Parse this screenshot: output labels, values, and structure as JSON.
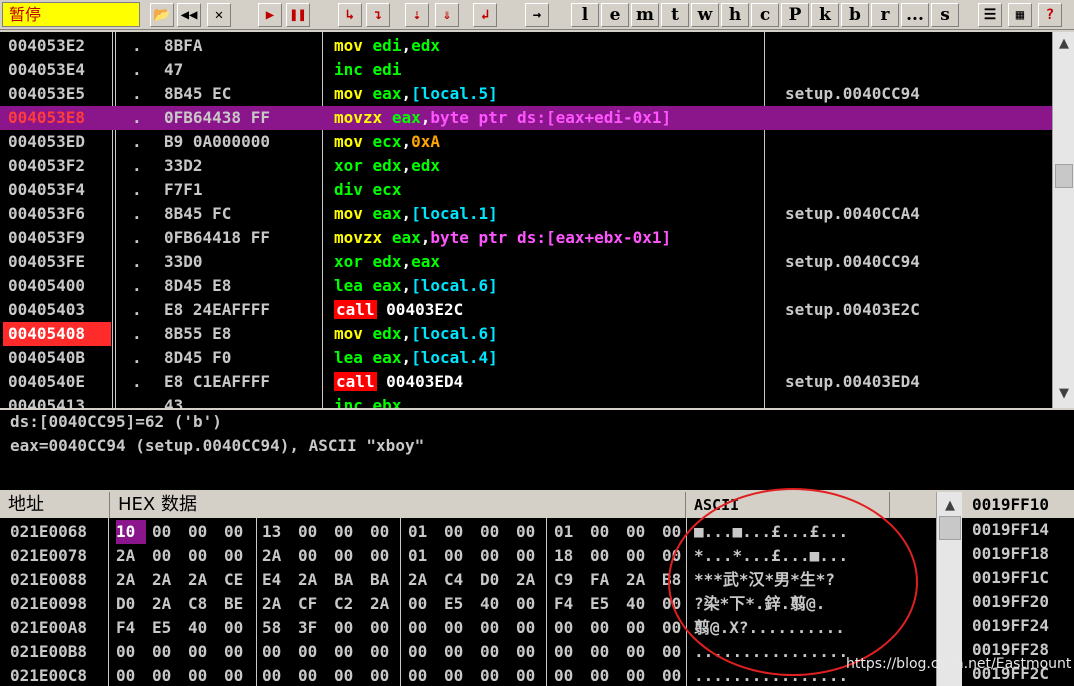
{
  "toolbar": {
    "status": "暂停",
    "buttons": [
      {
        "name": "open-icon",
        "glyph": "📂"
      },
      {
        "name": "rewind-icon",
        "glyph": "◀◀"
      },
      {
        "name": "close-icon",
        "glyph": "✕"
      },
      {
        "name": "run-icon",
        "glyph": "▶"
      },
      {
        "name": "pause-icon",
        "glyph": "❚❚"
      },
      {
        "name": "step-into-icon",
        "glyph": "↳"
      },
      {
        "name": "step-over-icon",
        "glyph": "↴"
      },
      {
        "name": "trace-into-icon",
        "glyph": "⇣"
      },
      {
        "name": "trace-over-icon",
        "glyph": "⇓"
      },
      {
        "name": "execute-till-return-icon",
        "glyph": "↲"
      },
      {
        "name": "goto-icon",
        "glyph": "→"
      }
    ],
    "letters": [
      "l",
      "e",
      "m",
      "t",
      "w",
      "h",
      "c",
      "P",
      "k",
      "b",
      "r",
      "...",
      "s"
    ],
    "right_buttons": [
      {
        "name": "list-icon",
        "glyph": "☰"
      },
      {
        "name": "grid-icon",
        "glyph": "▦"
      },
      {
        "name": "help-icon",
        "glyph": "?"
      }
    ]
  },
  "disasm": [
    {
      "addr": "004053E2",
      "bytes": "8BFA",
      "mn": "mov",
      "ops": [
        [
          "op-reg",
          "edi"
        ],
        [
          "op-plain",
          ","
        ],
        [
          "op-reg",
          "edx"
        ]
      ],
      "cmt": ""
    },
    {
      "addr": "004053E4",
      "bytes": "47",
      "mn": "inc",
      "ops": [
        [
          "op-reg",
          "edi"
        ]
      ],
      "cmt": ""
    },
    {
      "addr": "004053E5",
      "bytes": "8B45 EC",
      "mn": "mov",
      "ops": [
        [
          "op-reg",
          "eax"
        ],
        [
          "op-plain",
          ","
        ],
        [
          "op-mem",
          "[local.5]"
        ]
      ],
      "cmt": "setup.0040CC94"
    },
    {
      "addr": "004053E8",
      "bytes": "0FB64438 FF",
      "mn": "movzx",
      "ops": [
        [
          "op-reg",
          "eax"
        ],
        [
          "op-plain",
          ","
        ],
        [
          "op-bp",
          "byte ptr ds:[eax+edi-0x1]"
        ]
      ],
      "cmt": "",
      "hl": true
    },
    {
      "addr": "004053ED",
      "bytes": "B9 0A000000",
      "mn": "mov",
      "ops": [
        [
          "op-reg",
          "ecx"
        ],
        [
          "op-plain",
          ","
        ],
        [
          "op-imm",
          "0xA"
        ]
      ],
      "cmt": ""
    },
    {
      "addr": "004053F2",
      "bytes": "33D2",
      "mn": "xor",
      "ops": [
        [
          "op-reg",
          "edx"
        ],
        [
          "op-plain",
          ","
        ],
        [
          "op-reg",
          "edx"
        ]
      ],
      "cmt": ""
    },
    {
      "addr": "004053F4",
      "bytes": "F7F1",
      "mn": "div",
      "ops": [
        [
          "op-reg",
          "ecx"
        ]
      ],
      "cmt": ""
    },
    {
      "addr": "004053F6",
      "bytes": "8B45 FC",
      "mn": "mov",
      "ops": [
        [
          "op-reg",
          "eax"
        ],
        [
          "op-plain",
          ","
        ],
        [
          "op-mem",
          "[local.1]"
        ]
      ],
      "cmt": "setup.0040CCA4"
    },
    {
      "addr": "004053F9",
      "bytes": "0FB64418 FF",
      "mn": "movzx",
      "ops": [
        [
          "op-reg",
          "eax"
        ],
        [
          "op-plain",
          ","
        ],
        [
          "op-bp",
          "byte ptr ds:[eax+ebx-0x1]"
        ]
      ],
      "cmt": ""
    },
    {
      "addr": "004053FE",
      "bytes": "33D0",
      "mn": "xor",
      "ops": [
        [
          "op-reg",
          "edx"
        ],
        [
          "op-plain",
          ","
        ],
        [
          "op-reg",
          "eax"
        ]
      ],
      "cmt": "setup.0040CC94"
    },
    {
      "addr": "00405400",
      "bytes": "8D45 E8",
      "mn": "lea",
      "ops": [
        [
          "op-reg",
          "eax"
        ],
        [
          "op-plain",
          ","
        ],
        [
          "op-mem",
          "[local.6]"
        ]
      ],
      "cmt": ""
    },
    {
      "addr": "00405403",
      "bytes": "E8 24EAFFFF",
      "mn": "call",
      "ops": [
        [
          "op-plain",
          "00403E2C"
        ]
      ],
      "cmt": "setup.00403E2C"
    },
    {
      "addr": "00405408",
      "bytes": "8B55 E8",
      "mn": "mov",
      "ops": [
        [
          "op-reg",
          "edx"
        ],
        [
          "op-plain",
          ","
        ],
        [
          "op-mem",
          "[local.6]"
        ]
      ],
      "cmt": "",
      "bp": true
    },
    {
      "addr": "0040540B",
      "bytes": "8D45 F0",
      "mn": "lea",
      "ops": [
        [
          "op-reg",
          "eax"
        ],
        [
          "op-plain",
          ","
        ],
        [
          "op-mem",
          "[local.4]"
        ]
      ],
      "cmt": ""
    },
    {
      "addr": "0040540E",
      "bytes": "E8 C1EAFFFF",
      "mn": "call",
      "ops": [
        [
          "op-plain",
          "00403ED4"
        ]
      ],
      "cmt": "setup.00403ED4"
    },
    {
      "addr": "00405413",
      "bytes": "43",
      "mn": "inc",
      "ops": [
        [
          "op-reg",
          "ebx"
        ]
      ],
      "cmt": ""
    }
  ],
  "info": {
    "line1": "ds:[0040CC95]=62 ('b')",
    "line2": "eax=0040CC94 (setup.0040CC94), ASCII \"xboy\""
  },
  "dump": {
    "col_addr": "地址",
    "col_hex": "HEX 数据",
    "col_ascii": "ASCII",
    "rows": [
      {
        "addr": "021E0068",
        "bytes": [
          "10",
          "00",
          "00",
          "00",
          "13",
          "00",
          "00",
          "00",
          "01",
          "00",
          "00",
          "00",
          "01",
          "00",
          "00",
          "00"
        ],
        "ascii": "■...■...£...£..."
      },
      {
        "addr": "021E0078",
        "bytes": [
          "2A",
          "00",
          "00",
          "00",
          "2A",
          "00",
          "00",
          "00",
          "01",
          "00",
          "00",
          "00",
          "18",
          "00",
          "00",
          "00"
        ],
        "ascii": "*...*...£...■..."
      },
      {
        "addr": "021E0088",
        "bytes": [
          "2A",
          "2A",
          "2A",
          "CE",
          "E4",
          "2A",
          "BA",
          "BA",
          "2A",
          "C4",
          "D0",
          "2A",
          "C9",
          "FA",
          "2A",
          "B8"
        ],
        "ascii": "***武*汉*男*生*?"
      },
      {
        "addr": "021E0098",
        "bytes": [
          "D0",
          "2A",
          "C8",
          "BE",
          "2A",
          "CF",
          "C2",
          "2A",
          "00",
          "E5",
          "40",
          "00",
          "F4",
          "E5",
          "40",
          "00"
        ],
        "ascii": "?染*下*.鋅.翦@."
      },
      {
        "addr": "021E00A8",
        "bytes": [
          "F4",
          "E5",
          "40",
          "00",
          "58",
          "3F",
          "00",
          "00",
          "00",
          "00",
          "00",
          "00",
          "00",
          "00",
          "00",
          "00"
        ],
        "ascii": "翦@.X?.........."
      },
      {
        "addr": "021E00B8",
        "bytes": [
          "00",
          "00",
          "00",
          "00",
          "00",
          "00",
          "00",
          "00",
          "00",
          "00",
          "00",
          "00",
          "00",
          "00",
          "00",
          "00"
        ],
        "ascii": "................"
      },
      {
        "addr": "021E00C8",
        "bytes": [
          "00",
          "00",
          "00",
          "00",
          "00",
          "00",
          "00",
          "00",
          "00",
          "00",
          "00",
          "00",
          "00",
          "00",
          "00",
          "00"
        ],
        "ascii": "................"
      }
    ]
  },
  "stack": [
    "0019FF10",
    "0019FF14",
    "0019FF18",
    "0019FF1C",
    "0019FF20",
    "0019FF24",
    "0019FF28",
    "0019FF2C"
  ],
  "watermark": "https://blog.csdn.net/Eastmount"
}
